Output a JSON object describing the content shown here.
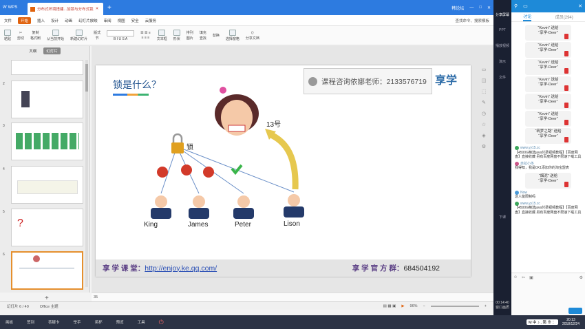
{
  "app": {
    "name": "WPS",
    "tab_title": "分布式环境搭建...加锁与分布式锁",
    "user": "韩论坛",
    "window_controls": [
      "□",
      "—",
      "✕"
    ]
  },
  "menu": {
    "file": "文件",
    "items": [
      "开始",
      "插入",
      "设计",
      "动画",
      "幻灯片放映",
      "审阅",
      "视图",
      "安全",
      "云服务"
    ],
    "search": "查找命令、搜索模板"
  },
  "ribbon": {
    "paste": "粘贴",
    "cut": "剪切",
    "copy": "复制",
    "format_painter": "格式刷",
    "from_current": "从当前开始",
    "new_slide": "新建幻灯片",
    "layout": "版式",
    "section": "节",
    "textbox": "文本框",
    "shape": "形状",
    "arrange": "排列",
    "image": "图片",
    "fill": "填充",
    "find": "查找",
    "replace": "替换",
    "select": "选择窗格",
    "share": "分享文档"
  },
  "sidebar": {
    "tab_outline": "大纲",
    "tab_slides": "幻灯片",
    "thumb_numbers": [
      "2",
      "3",
      "4",
      "5",
      "6"
    ]
  },
  "slide": {
    "title": "锁是什么？",
    "consult": "课程咨询依娜老师：2133576719",
    "logo": "享学",
    "lock_label": "锁",
    "number_label": "13号",
    "people": [
      "King",
      "James",
      "Peter",
      "Lison"
    ],
    "footer_left_label": "享 学 课 堂：",
    "footer_link": "http://enjoy.ke.qq.com/",
    "footer_right_label": "享 学 官 方 群：",
    "footer_group": "684504192"
  },
  "notes": {
    "number": "35"
  },
  "status": {
    "slide": "幻灯片 6 / 40",
    "theme": "Office 主题",
    "zoom": "96%"
  },
  "taskbar": {
    "items": [
      "画板",
      "签到",
      "答疑卡",
      "举手",
      "奖杯",
      "预览",
      "工具"
    ],
    "ime": "M 中 ♪ , 简 ⊕ ：",
    "time": "20:13",
    "date": "2018/12/24"
  },
  "sidestrip": {
    "items": [
      "分享屏幕",
      "PPT",
      "播放视频",
      "演示",
      "文件"
    ],
    "download": "下课",
    "time": "00:14:40",
    "quality": "窗口画质"
  },
  "chat": {
    "tabs": [
      "讨论",
      "成员(294)"
    ],
    "gifts": [
      {
        "from": "“Kevin” 送给",
        "to": "“享学-Deer”"
      },
      {
        "from": "“Kevin” 送给",
        "to": "“享学-Deer”"
      },
      {
        "from": "“Kevin” 送给",
        "to": "“享学-Deer”"
      },
      {
        "from": "“Kevin” 送给",
        "to": "“享学-Deer”"
      },
      {
        "from": "“Kevin” 送给",
        "to": "“享学-Deer”"
      },
      {
        "from": "“Kevin” 送给",
        "to": "“享学-Deer”"
      },
      {
        "from": "“筑梦之路” 送给",
        "to": "“享学-Deer”"
      }
    ],
    "messages": [
      {
        "user": "www.yy15.cc",
        "text": "【4500G精选java付费视频教程】【百度网盘】直接收藏 另有百度网盘不限速下载工具"
      },
      {
        "user": "赤拉小冬",
        "text": "我得知，我是0X1添加你的淘宝盟表"
      }
    ],
    "gift2": {
      "from": "“烟泥” 送给",
      "to": "“享学-Deer”"
    },
    "messages2": [
      {
        "user": "Now",
        "text": "这人能限制吗"
      },
      {
        "user": "www.yy15.cc",
        "text": "【4500G精选java付费视频教程】【百度网盘】直接收藏 另有百度网盘不限速下载工具"
      }
    ]
  }
}
